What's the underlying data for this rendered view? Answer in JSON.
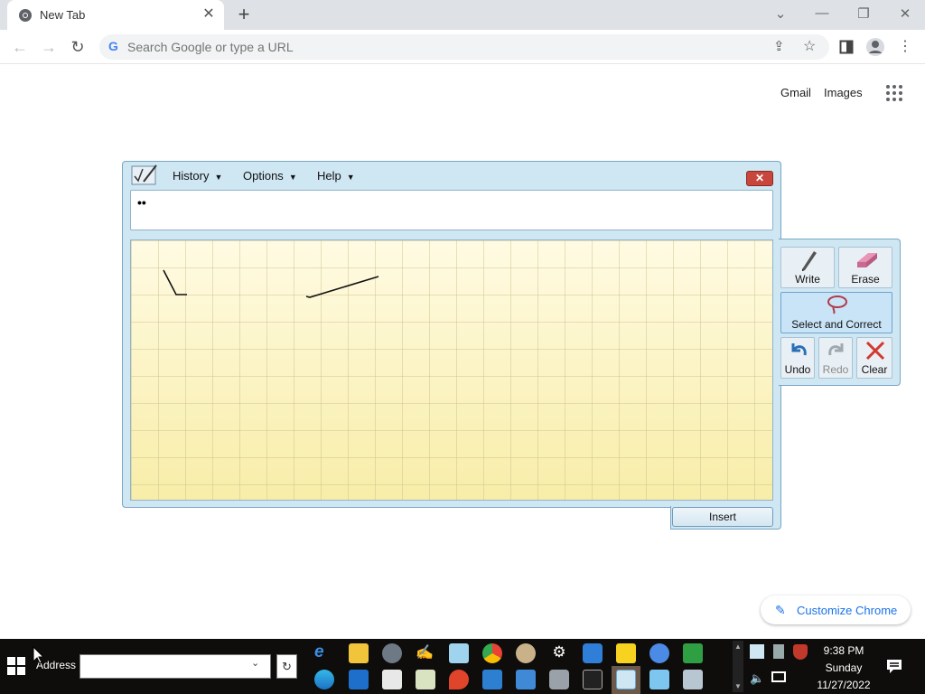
{
  "browser": {
    "tab_title": "New Tab",
    "omnibox_placeholder": "Search Google or type a URL",
    "links": {
      "gmail": "Gmail",
      "images": "Images"
    },
    "customize_label": "Customize Chrome",
    "accent": "#1a73e8"
  },
  "input_panel": {
    "menus": [
      "History",
      "Options",
      "Help"
    ],
    "preview_text": "••",
    "tools": {
      "write": "Write",
      "erase": "Erase",
      "select_correct": "Select and Correct",
      "undo": "Undo",
      "redo": "Redo",
      "clear": "Clear"
    },
    "insert_label": "Insert"
  },
  "taskbar": {
    "address_label": "Address",
    "address_value": "",
    "clock": {
      "time": "9:38 PM",
      "day": "Sunday",
      "date": "11/27/2022"
    }
  }
}
